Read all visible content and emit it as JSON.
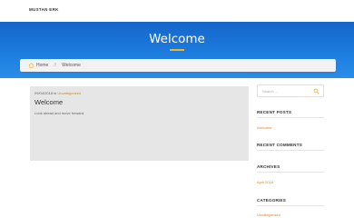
{
  "site": {
    "title": "MUSTAN ERK"
  },
  "hero": {
    "title": "Welcome",
    "accent": "#f0b429",
    "gradient_top": "#1565c9",
    "gradient_bottom": "#2a8ee8"
  },
  "breadcrumb": {
    "home_icon": "home-icon",
    "home_label": "Home",
    "separator": "//",
    "current": "Welcome"
  },
  "post": {
    "date": "09/04/2018",
    "in_label": " in ",
    "category": "Uncategorized",
    "title": "Welcome",
    "excerpt": "Look ahead and move forward."
  },
  "sidebar": {
    "search": {
      "placeholder": "Search ...",
      "icon": "search-icon"
    },
    "recent_posts": {
      "title": "RECENT POSTS",
      "items": [
        "Welcome"
      ]
    },
    "recent_comments": {
      "title": "RECENT COMMENTS"
    },
    "archives": {
      "title": "ARCHIVES",
      "items": [
        "April 2018"
      ]
    },
    "categories": {
      "title": "CATEGORIES",
      "items": [
        "Uncategorized"
      ]
    }
  }
}
